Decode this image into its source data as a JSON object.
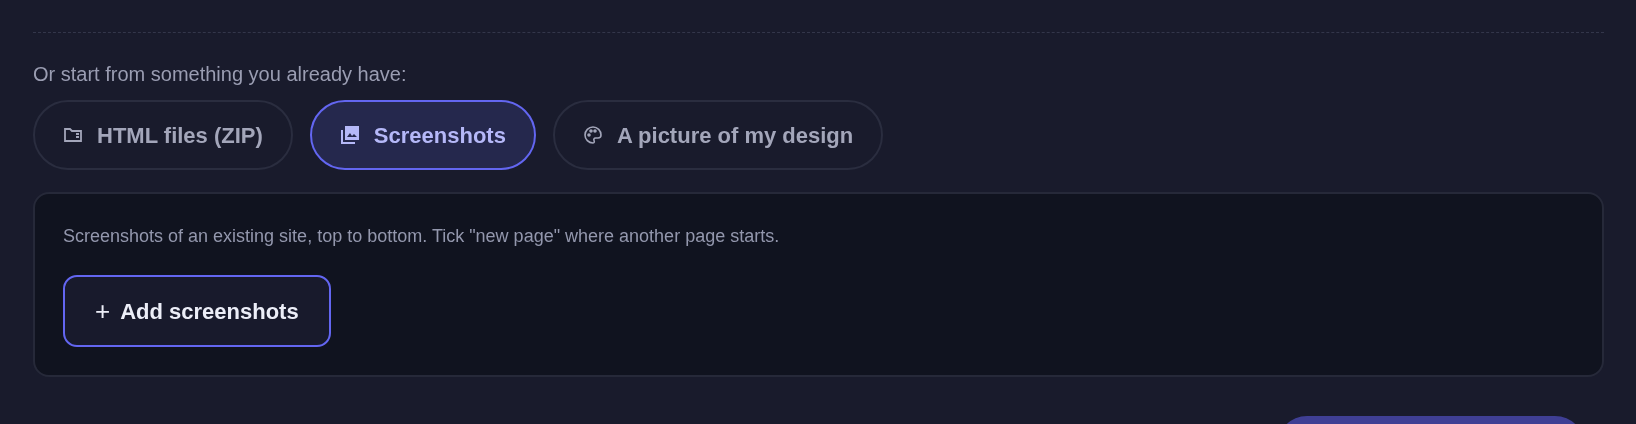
{
  "prompt": "Or start from something you already have:",
  "tabs": [
    {
      "kind": "folder",
      "label": "HTML files (ZIP)",
      "selected": false
    },
    {
      "kind": "images",
      "label": "Screenshots",
      "selected": true
    },
    {
      "kind": "palette",
      "label": "A picture of my design",
      "selected": false
    }
  ],
  "panel": {
    "description": "Screenshots of an existing site, top to bottom. Tick \"new page\" where another page starts.",
    "button": {
      "icon": "+",
      "label": "Add screenshots"
    }
  }
}
